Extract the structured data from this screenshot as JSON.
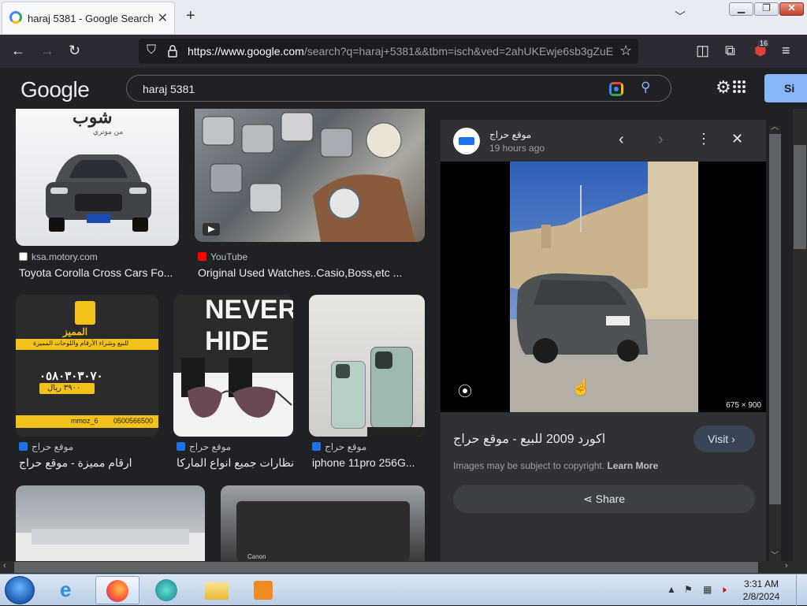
{
  "browser": {
    "tab_title": "haraj 5381 - Google Search",
    "new_tab": "+",
    "url_host": "https://www.google.com",
    "url_rest": "/search?q=haraj+5381&&tbm=isch&ved=2ahUKEwje6sb3gZuE",
    "notification_count": "16"
  },
  "google": {
    "logo": "Google",
    "query": "haraj 5381",
    "signin_label": "Si"
  },
  "results": [
    {
      "source": "ksa.motory.com",
      "caption": "Toyota Corolla Cross Cars Fo...",
      "fav_color": "#e8eaed"
    },
    {
      "source": "YouTube",
      "caption": "Original Used Watches..Casio,Boss,etc ...",
      "fav_color": "#ff0000"
    },
    {
      "source": "موقع حراج",
      "caption": "ارقام مميزة - موقع حراج",
      "fav_color": "#1a73e8"
    },
    {
      "source": "موقع حراج",
      "caption": "نظارات جميع انواع الماركا...",
      "fav_color": "#1a73e8"
    },
    {
      "source": "موقع حراج",
      "caption": "iphone 11pro 256G...",
      "fav_color": "#1a73e8"
    }
  ],
  "thumb_text": {
    "car_brand": "شوب",
    "car_brand_sub": "من موتري",
    "vip_title": "المميز",
    "vip_subtitle": "للبيع وشراء الأرقام واللوحات المميزة",
    "vip_number": "٠٥٨٠٣٠٣٠٧٠",
    "vip_price": "٣٩٠٠ ريال",
    "vip_contact": "0500566500",
    "vip_handle": "mmoz_6",
    "never": "NEVER",
    "hide": "HIDE",
    "canon": "Canon"
  },
  "panel": {
    "publisher": "موقع حراج",
    "time": "19 hours ago",
    "dimensions": "675 × 900",
    "title": "اكورد 2009 للبيع - موقع حراج",
    "visit_label": "Visit",
    "copyright_text": "Images may be subject to copyright.",
    "learn_more": "Learn More",
    "share_label": "Share"
  },
  "taskbar": {
    "time": "3:31 AM",
    "date": "2/8/2024"
  }
}
